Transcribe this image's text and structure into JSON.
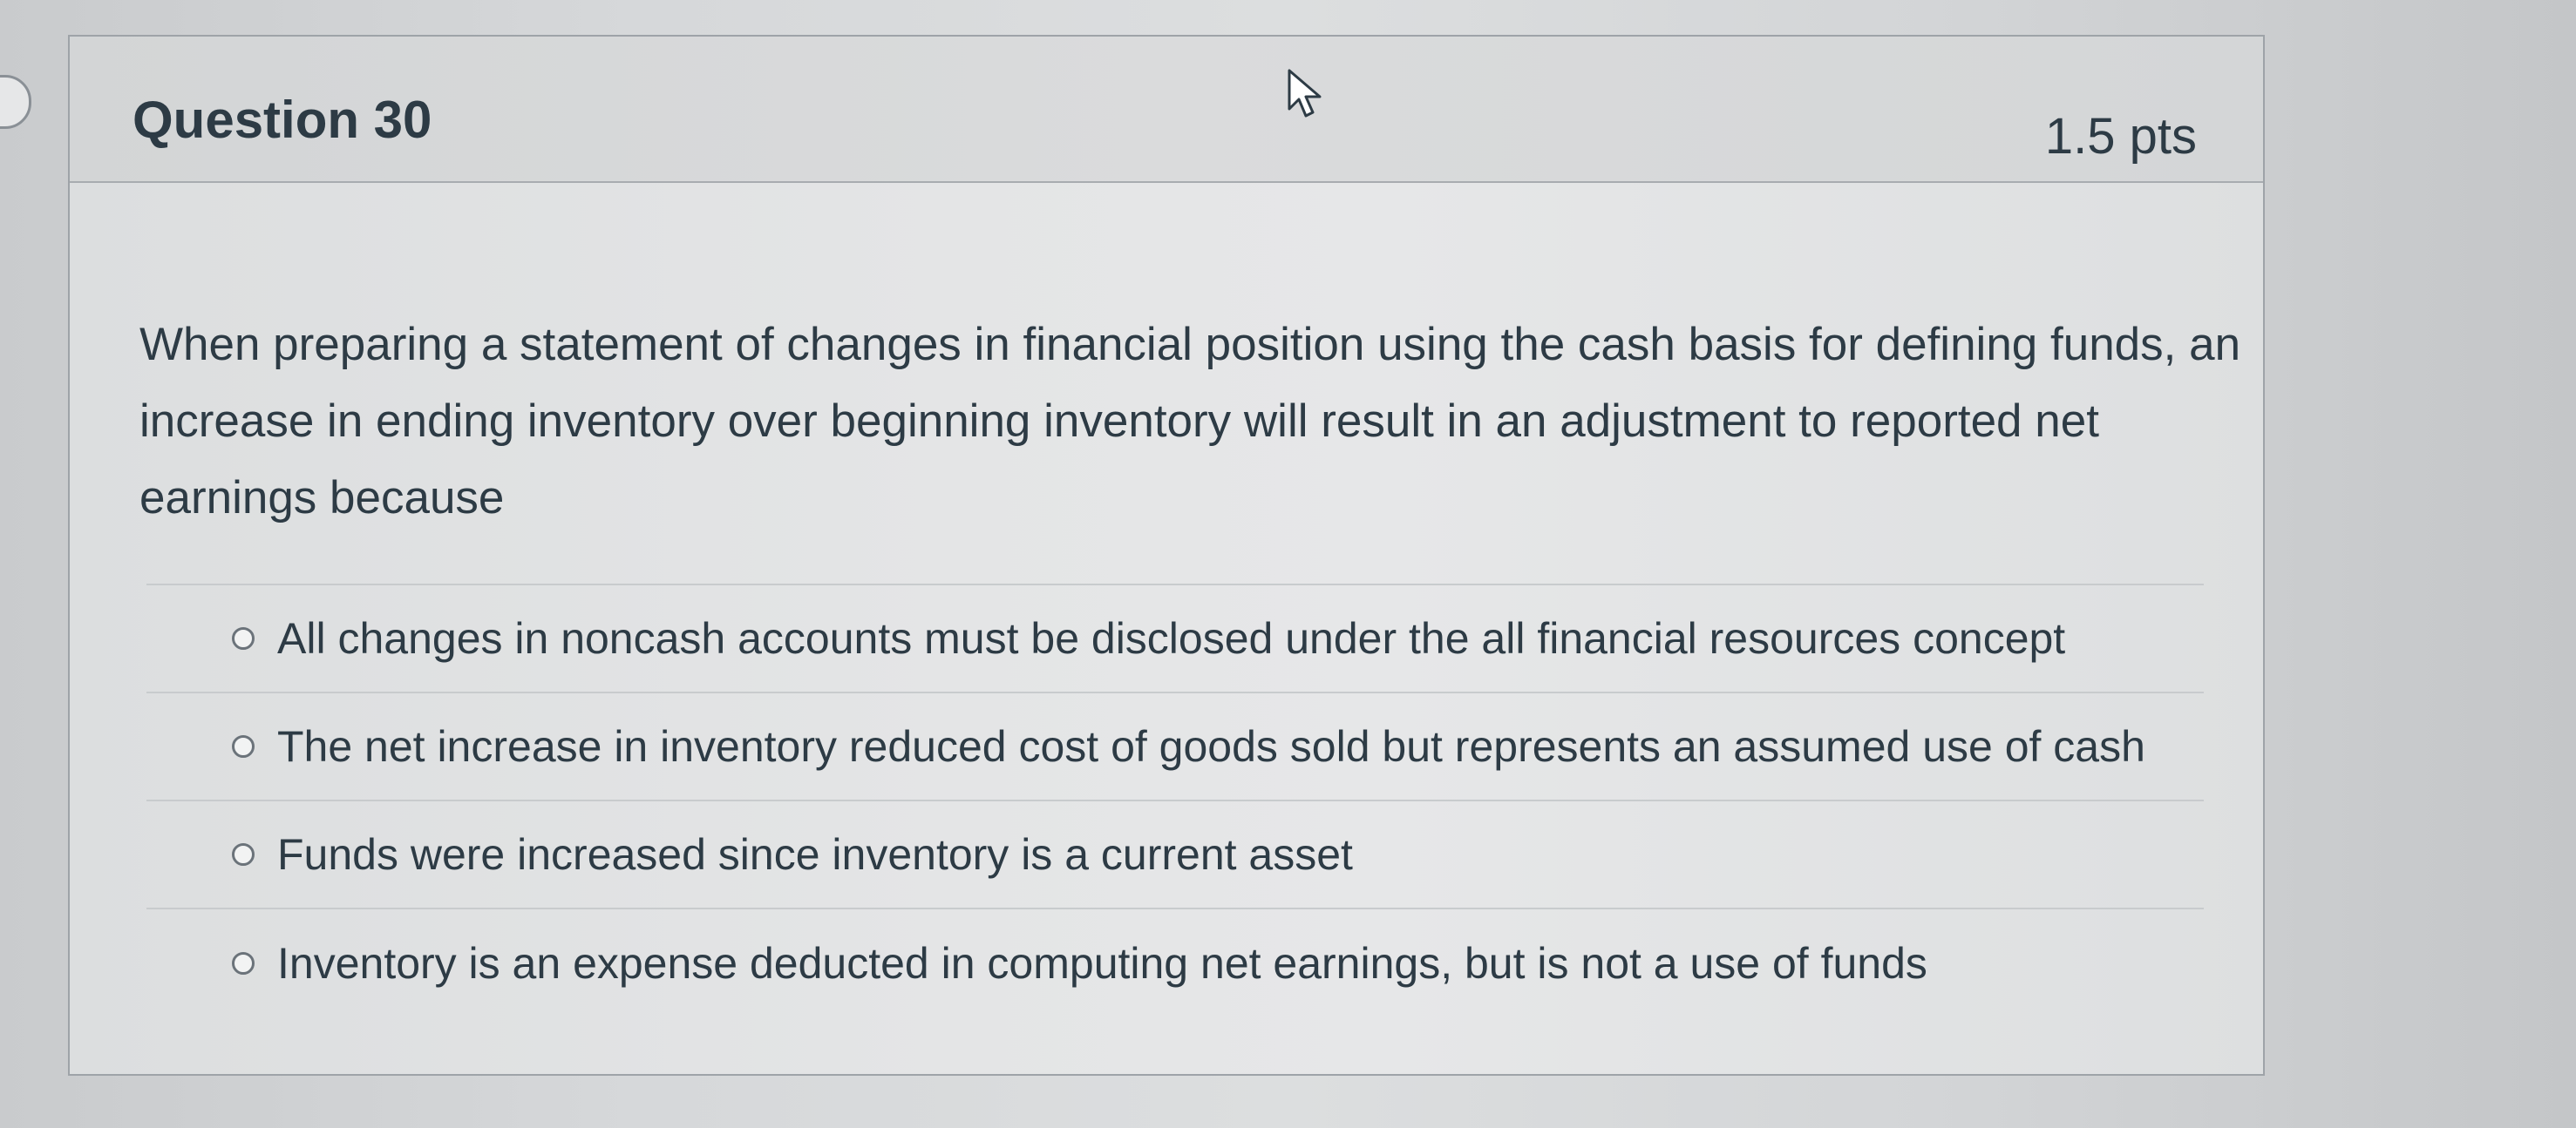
{
  "question": {
    "title": "Question 30",
    "points": "1.5 pts",
    "text": "When preparing a statement of changes in financial position using the cash basis for defining funds, an increase in ending inventory over beginning inventory will result in an adjustment to reported net earnings because",
    "answers": [
      {
        "label": "All changes in noncash accounts must be disclosed under the all financial resources concept",
        "selected": false
      },
      {
        "label": "The net increase in inventory reduced cost of goods sold but represents an assumed use of cash",
        "selected": false
      },
      {
        "label": "Funds were increased since inventory is a current asset",
        "selected": false
      },
      {
        "label": "Inventory is an expense deducted in computing net earnings, but is not a use of funds",
        "selected": false
      }
    ]
  },
  "icons": {
    "cursor": "mouse-pointer-icon",
    "radio": "radio-unselected-icon"
  },
  "colors": {
    "text": "#2d3b45",
    "border": "#9ea3a8",
    "header_bg": "#d8dadb"
  }
}
